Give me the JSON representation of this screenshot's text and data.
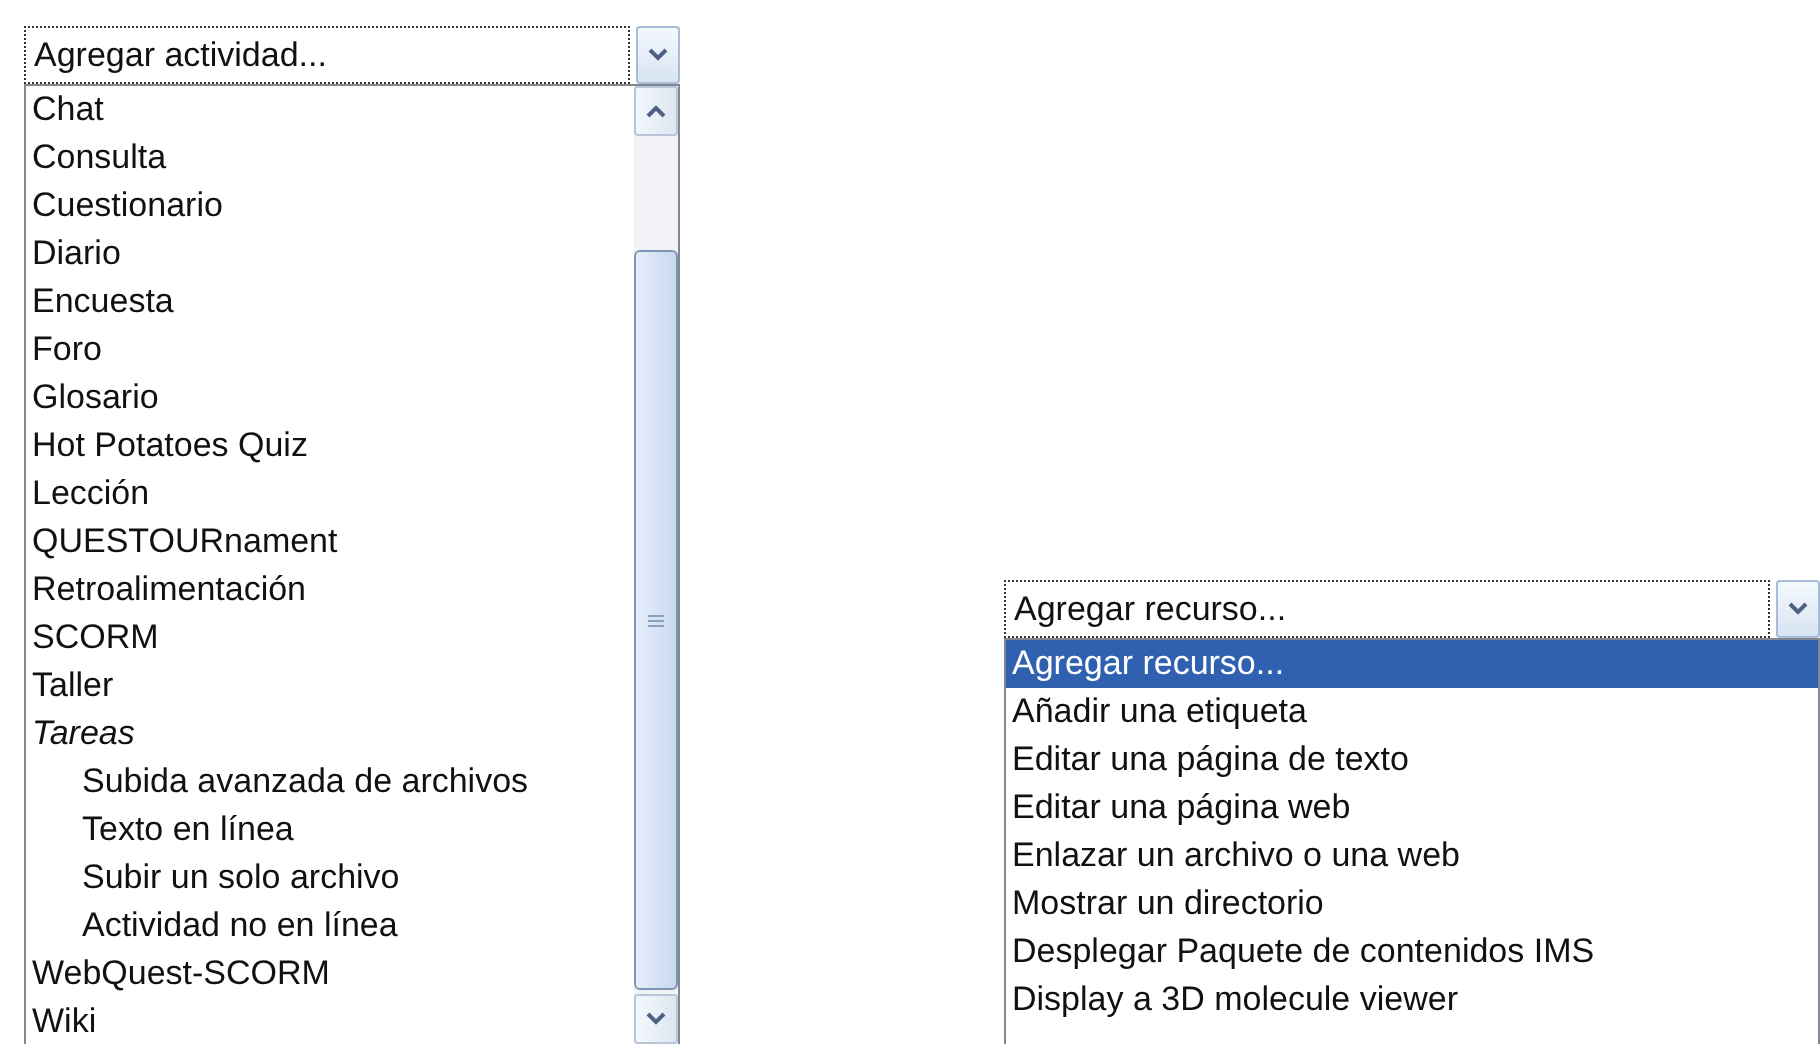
{
  "activity_select": {
    "value": "Agregar actividad...",
    "options": [
      {
        "label": "Chat",
        "kind": "option",
        "selected": false
      },
      {
        "label": "Consulta",
        "kind": "option",
        "selected": false
      },
      {
        "label": "Cuestionario",
        "kind": "option",
        "selected": false
      },
      {
        "label": "Diario",
        "kind": "option",
        "selected": false
      },
      {
        "label": "Encuesta",
        "kind": "option",
        "selected": false
      },
      {
        "label": "Foro",
        "kind": "option",
        "selected": false
      },
      {
        "label": "Glosario",
        "kind": "option",
        "selected": false
      },
      {
        "label": "Hot Potatoes Quiz",
        "kind": "option",
        "selected": false
      },
      {
        "label": "Lección",
        "kind": "option",
        "selected": false
      },
      {
        "label": "QUESTOURnament",
        "kind": "option",
        "selected": false
      },
      {
        "label": "Retroalimentación",
        "kind": "option",
        "selected": false
      },
      {
        "label": "SCORM",
        "kind": "option",
        "selected": false
      },
      {
        "label": "Taller",
        "kind": "option",
        "selected": false
      },
      {
        "label": "Tareas",
        "kind": "group",
        "children": [
          {
            "label": "Subida avanzada de archivos",
            "kind": "option",
            "selected": false
          },
          {
            "label": "Texto en línea",
            "kind": "option",
            "selected": false
          },
          {
            "label": "Subir un solo archivo",
            "kind": "option",
            "selected": false
          },
          {
            "label": "Actividad no en línea",
            "kind": "option",
            "selected": false
          }
        ]
      },
      {
        "label": "WebQuest-SCORM",
        "kind": "option",
        "selected": false
      },
      {
        "label": "Wiki",
        "kind": "option",
        "selected": false
      }
    ]
  },
  "resource_select": {
    "value": "Agregar recurso...",
    "options": [
      {
        "label": "Agregar recurso...",
        "kind": "option",
        "selected": true
      },
      {
        "label": "Añadir una etiqueta",
        "kind": "option",
        "selected": false
      },
      {
        "label": "Editar una página de texto",
        "kind": "option",
        "selected": false
      },
      {
        "label": "Editar una página web",
        "kind": "option",
        "selected": false
      },
      {
        "label": "Enlazar un archivo o una web",
        "kind": "option",
        "selected": false
      },
      {
        "label": "Mostrar un directorio",
        "kind": "option",
        "selected": false
      },
      {
        "label": "Desplegar Paquete de contenidos IMS",
        "kind": "option",
        "selected": false
      },
      {
        "label": "Display a 3D molecule viewer",
        "kind": "option",
        "selected": false
      }
    ]
  }
}
